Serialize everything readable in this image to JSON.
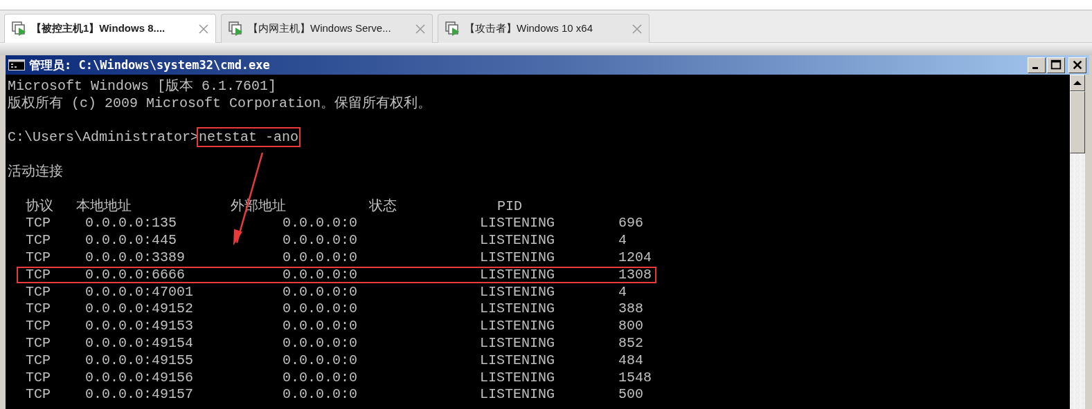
{
  "tabs": [
    {
      "label": "【被控主机1】Windows 8....",
      "selected": true
    },
    {
      "label": "【内网主机】Windows Serve...",
      "selected": false
    },
    {
      "label": "【攻击者】Windows 10 x64",
      "selected": false
    }
  ],
  "window": {
    "title": "管理员: C:\\Windows\\system32\\cmd.exe"
  },
  "console": {
    "banner": [
      "Microsoft Windows [版本 6.1.7601]",
      "版权所有 (c) 2009 Microsoft Corporation。保留所有权利。"
    ],
    "prompt": "C:\\Users\\Administrator>",
    "command": "netstat -ano",
    "command_highlighted": true,
    "section_title": "活动连接",
    "columns": [
      "协议",
      "本地地址",
      "外部地址",
      "状态",
      "PID"
    ],
    "rows": [
      {
        "protocol": "TCP",
        "local": "0.0.0.0:135",
        "foreign": "0.0.0.0:0",
        "state": "LISTENING",
        "pid": "696",
        "highlighted": false
      },
      {
        "protocol": "TCP",
        "local": "0.0.0.0:445",
        "foreign": "0.0.0.0:0",
        "state": "LISTENING",
        "pid": "4",
        "highlighted": false
      },
      {
        "protocol": "TCP",
        "local": "0.0.0.0:3389",
        "foreign": "0.0.0.0:0",
        "state": "LISTENING",
        "pid": "1204",
        "highlighted": false
      },
      {
        "protocol": "TCP",
        "local": "0.0.0.0:6666",
        "foreign": "0.0.0.0:0",
        "state": "LISTENING",
        "pid": "1308",
        "highlighted": true
      },
      {
        "protocol": "TCP",
        "local": "0.0.0.0:47001",
        "foreign": "0.0.0.0:0",
        "state": "LISTENING",
        "pid": "4",
        "highlighted": false
      },
      {
        "protocol": "TCP",
        "local": "0.0.0.0:49152",
        "foreign": "0.0.0.0:0",
        "state": "LISTENING",
        "pid": "388",
        "highlighted": false
      },
      {
        "protocol": "TCP",
        "local": "0.0.0.0:49153",
        "foreign": "0.0.0.0:0",
        "state": "LISTENING",
        "pid": "800",
        "highlighted": false
      },
      {
        "protocol": "TCP",
        "local": "0.0.0.0:49154",
        "foreign": "0.0.0.0:0",
        "state": "LISTENING",
        "pid": "852",
        "highlighted": false
      },
      {
        "protocol": "TCP",
        "local": "0.0.0.0:49155",
        "foreign": "0.0.0.0:0",
        "state": "LISTENING",
        "pid": "484",
        "highlighted": false
      },
      {
        "protocol": "TCP",
        "local": "0.0.0.0:49156",
        "foreign": "0.0.0.0:0",
        "state": "LISTENING",
        "pid": "1548",
        "highlighted": false
      },
      {
        "protocol": "TCP",
        "local": "0.0.0.0:49157",
        "foreign": "0.0.0.0:0",
        "state": "LISTENING",
        "pid": "500",
        "highlighted": false
      }
    ]
  }
}
